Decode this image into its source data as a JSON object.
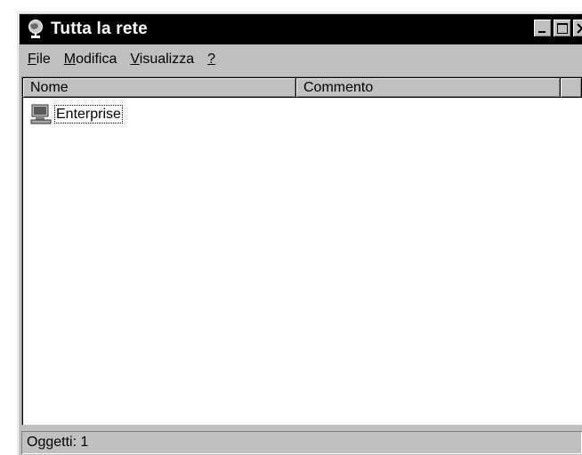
{
  "window": {
    "title": "Tutta la rete"
  },
  "menu": [
    {
      "accel": "F",
      "rest": "ile"
    },
    {
      "accel": "M",
      "rest": "odifica"
    },
    {
      "accel": "V",
      "rest": "isualizza"
    },
    {
      "accel": "?",
      "rest": ""
    }
  ],
  "columns": {
    "name": "Nome",
    "comment": "Commento"
  },
  "items": [
    {
      "label": "Enterprise",
      "icon": "network-domain-icon"
    }
  ],
  "status": {
    "text": "Oggetti: 1"
  }
}
